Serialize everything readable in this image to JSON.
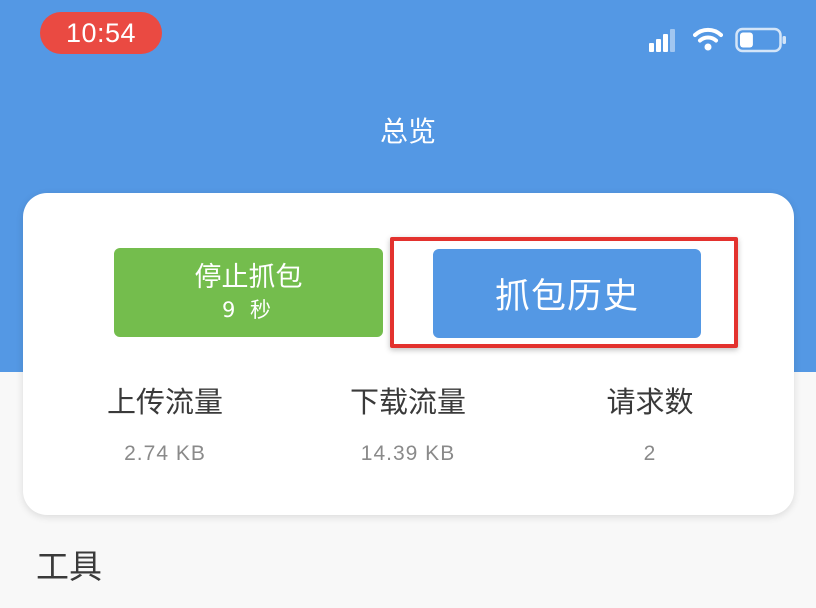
{
  "status_bar": {
    "time": "10:54",
    "icons": [
      "signal-icon",
      "wifi-icon",
      "battery-icon"
    ],
    "battery_level": 0.35
  },
  "header": {
    "title": "总览"
  },
  "capture": {
    "stop_button": {
      "label": "停止抓包",
      "elapsed": "9 秒"
    },
    "history_button": {
      "label": "抓包历史"
    }
  },
  "stats": {
    "upload": {
      "label": "上传流量",
      "value": "2.74 KB"
    },
    "download": {
      "label": "下载流量",
      "value": "14.39 KB"
    },
    "requests": {
      "label": "请求数",
      "value": "2"
    }
  },
  "tools": {
    "title": "工具"
  },
  "colors": {
    "header_blue": "#5498e4",
    "stop_green": "#74bd4d",
    "time_pill_red": "#ea4a42",
    "highlight_red": "#e3322e"
  }
}
